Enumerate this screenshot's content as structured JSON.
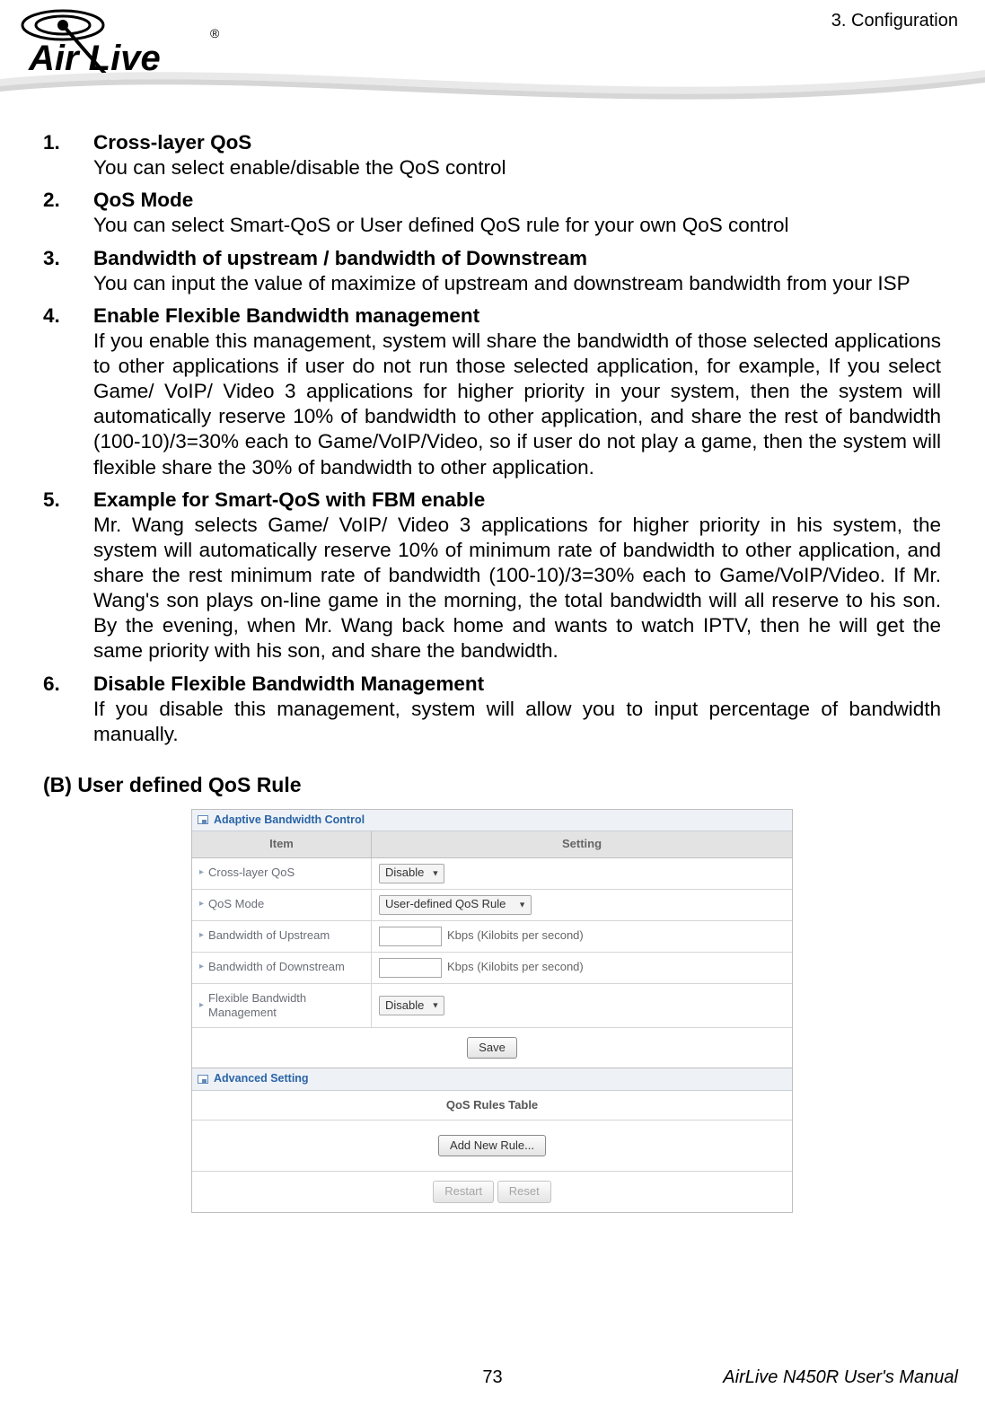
{
  "header": {
    "chapter": "3.  Configuration",
    "logo_brand": "Air Live",
    "logo_reg": "®"
  },
  "items": [
    {
      "num": "1.",
      "title": "Cross-layer QoS",
      "body": "You can select enable/disable the QoS control"
    },
    {
      "num": "2.",
      "title": "QoS Mode",
      "body": "You can select Smart-QoS or User defined QoS rule for your own QoS control"
    },
    {
      "num": "3.",
      "title": "Bandwidth of upstream / bandwidth of Downstream",
      "body": "You can input the value of maximize of upstream and downstream bandwidth from your ISP"
    },
    {
      "num": "4.",
      "title": "Enable Flexible Bandwidth management",
      "body": "If you enable this management, system will share the bandwidth of those selected applications to other applications if user do not run those selected application, for example, If you select Game/ VoIP/ Video 3 applications for higher priority in your system, then the system will automatically reserve 10% of bandwidth to other application, and share the rest of bandwidth (100-10)/3=30% each to Game/VoIP/Video, so if user do not play a game, then the system will flexible share the 30% of bandwidth to other application."
    },
    {
      "num": "5.",
      "title": "Example for Smart-QoS with FBM enable",
      "body": "Mr. Wang selects Game/ VoIP/ Video 3 applications for higher priority in his system, the system will automatically reserve 10% of minimum rate of bandwidth to other application, and share the rest minimum rate of bandwidth (100-10)/3=30% each to Game/VoIP/Video. If Mr. Wang's son plays on-line game in the morning, the total bandwidth will all reserve to his son. By the evening, when Mr. Wang back home and wants to watch IPTV, then he will get the same priority with his son, and share the bandwidth."
    },
    {
      "num": "6.",
      "title": "Disable Flexible Bandwidth Management",
      "body": "If you disable this management, system will allow you to input percentage of bandwidth manually."
    }
  ],
  "section_b_title": "(B) User defined QoS Rule",
  "figure": {
    "panel1_title": "Adaptive Bandwidth Control",
    "th_item": "Item",
    "th_setting": "Setting",
    "rows": {
      "cross_layer": {
        "label": "Cross-layer QoS",
        "value": "Disable"
      },
      "qos_mode": {
        "label": "QoS Mode",
        "value": "User-defined QoS Rule"
      },
      "bw_up": {
        "label": "Bandwidth of Upstream",
        "unit": "Kbps (Kilobits per second)"
      },
      "bw_down": {
        "label": "Bandwidth of Downstream",
        "unit": "Kbps (Kilobits per second)"
      },
      "fbm": {
        "label": "Flexible Bandwidth Management",
        "value": "Disable"
      }
    },
    "save": "Save",
    "panel2_title": "Advanced Setting",
    "rules_table_title": "QoS Rules Table",
    "add_rule": "Add New Rule...",
    "restart": "Restart",
    "reset": "Reset"
  },
  "footer": {
    "page_number": "73",
    "manual_title": "AirLive N450R User's Manual"
  }
}
